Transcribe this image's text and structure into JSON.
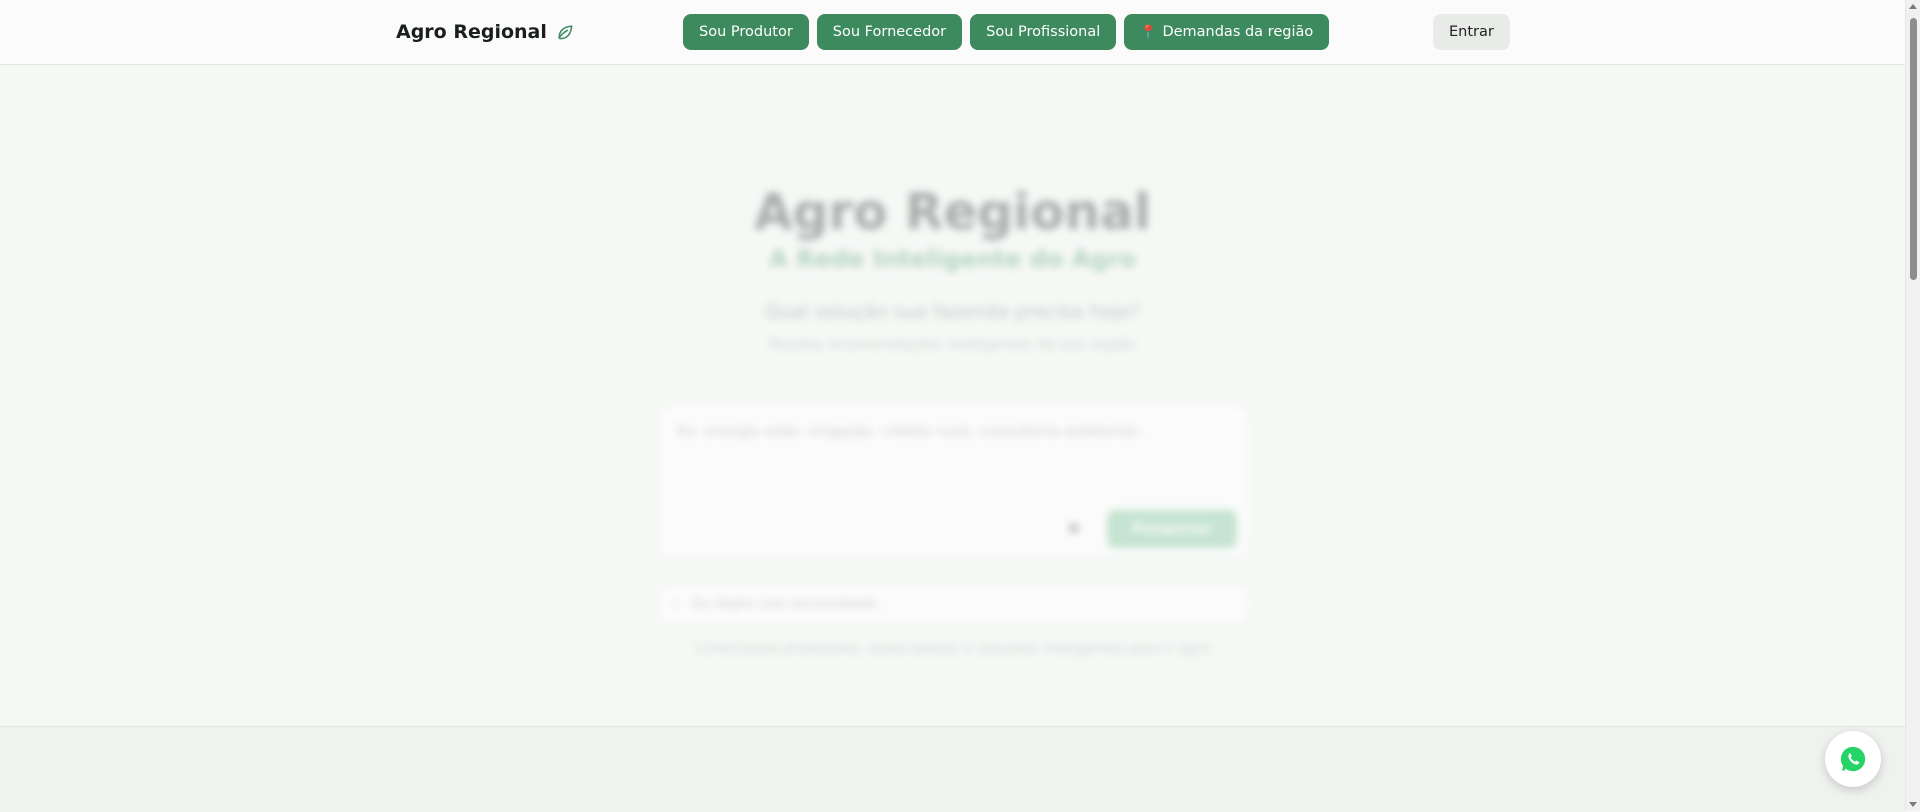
{
  "header": {
    "brand": "Agro Regional",
    "brand_icon": "leaf-icon",
    "nav": {
      "produtor": "Sou Produtor",
      "fornecedor": "Sou Fornecedor",
      "profissional": "Sou Profissional",
      "demandas": "Demandas da região",
      "demandas_icon": "map-pin-icon"
    },
    "login": "Entrar"
  },
  "hero": {
    "title": "Agro Regional",
    "subtitle": "A Rede Inteligente do Agro",
    "question": "Qual solução sua fazenda precisa hoje?",
    "note": "Receba recomendações inteligentes da sua região",
    "ask_placeholder": "Ex: energia solar, irrigação, crédito rural, consultoria ambiental...",
    "send_label": "Pesquisar",
    "mini_search_placeholder": "Ou digite sua necessidade...",
    "footer_text": "Conectando produtores, especialistas e soluções inteligentes para o agro"
  },
  "colors": {
    "accent": "#3d8a5e",
    "whatsapp": "#25d366"
  },
  "fab": {
    "icon": "whatsapp-icon"
  }
}
